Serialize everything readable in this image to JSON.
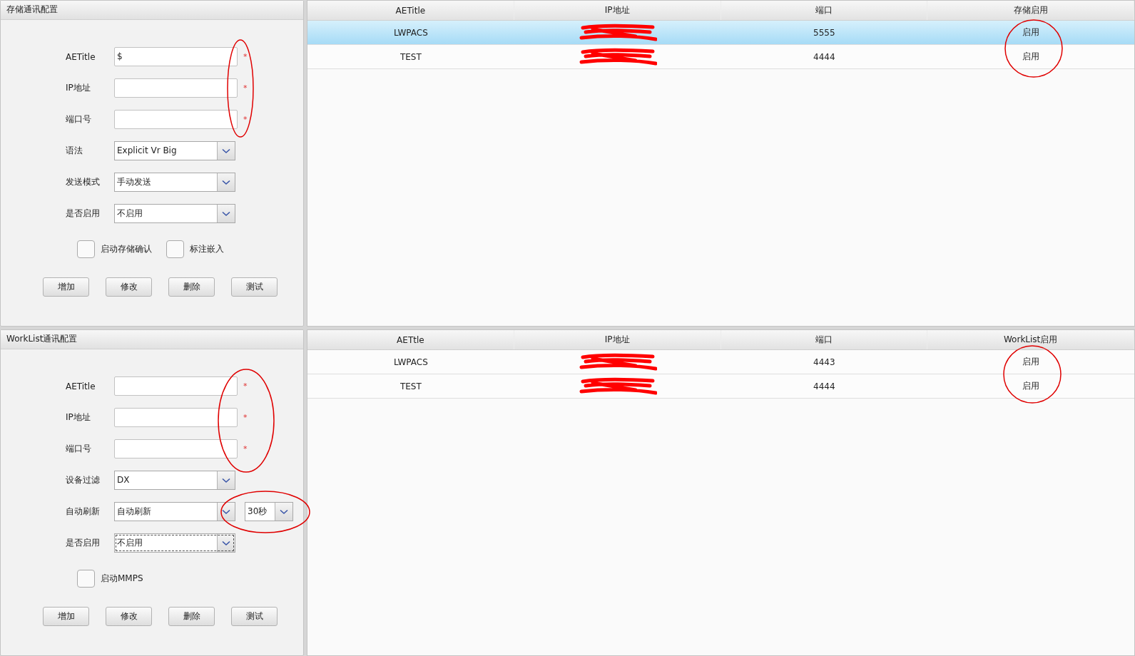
{
  "storage_panel": {
    "title": "存储通讯配置",
    "fields": [
      {
        "kind": "text",
        "label": "AETitle",
        "value": "$",
        "mark": "*"
      },
      {
        "kind": "text",
        "label": "IP地址",
        "mark": "*"
      },
      {
        "kind": "text",
        "label": "端口号",
        "mark": "*"
      },
      {
        "kind": "select",
        "label": "语法",
        "value": "Explicit Vr Big",
        "focused": false
      },
      {
        "kind": "select",
        "label": "发送模式",
        "value": "手动发送",
        "focused": false
      },
      {
        "kind": "select",
        "label": "是否启用",
        "value": "不启用",
        "focused": false
      }
    ],
    "checkboxes": [
      {
        "label": "启动存储确认",
        "checked": false
      },
      {
        "label": "标注嵌入",
        "checked": false
      }
    ],
    "buttons": [
      "增加",
      "修改",
      "删除",
      "测试"
    ]
  },
  "storage_table": {
    "columns": [
      "AETitle",
      "IP地址",
      "端口",
      "存储启用"
    ],
    "rows": [
      {
        "aetitle": "LWPACS",
        "port": "5555",
        "enabled": "启用",
        "selected": true
      },
      {
        "aetitle": "TEST",
        "port": "4444",
        "enabled": "启用",
        "selected": false
      }
    ]
  },
  "worklist_panel": {
    "title": "WorkList通讯配置",
    "fields": [
      {
        "kind": "text",
        "label": "AETitle",
        "mark": "*"
      },
      {
        "kind": "text",
        "label": "IP地址",
        "mark": "*"
      },
      {
        "kind": "text",
        "label": "端口号",
        "mark": "*"
      },
      {
        "kind": "select",
        "label": "设备过滤",
        "value": "DX",
        "focused": false
      },
      {
        "kind": "select",
        "label": "自动刷新",
        "value": "自动刷新",
        "extra": "30秒",
        "focused": false
      },
      {
        "kind": "select",
        "label": "是否启用",
        "value": "不启用",
        "focused": true
      }
    ],
    "checkboxes": [
      {
        "label": "启动MMPS",
        "checked": false
      }
    ],
    "buttons": [
      "增加",
      "修改",
      "删除",
      "测试"
    ]
  },
  "worklist_table": {
    "columns": [
      "AETtle",
      "IP地址",
      "端口",
      "WorkList启用"
    ],
    "rows": [
      {
        "aetitle": "LWPACS",
        "port": "4443",
        "enabled": "启用",
        "selected": false
      },
      {
        "aetitle": "TEST",
        "port": "4444",
        "enabled": "启用",
        "selected": false
      }
    ]
  }
}
